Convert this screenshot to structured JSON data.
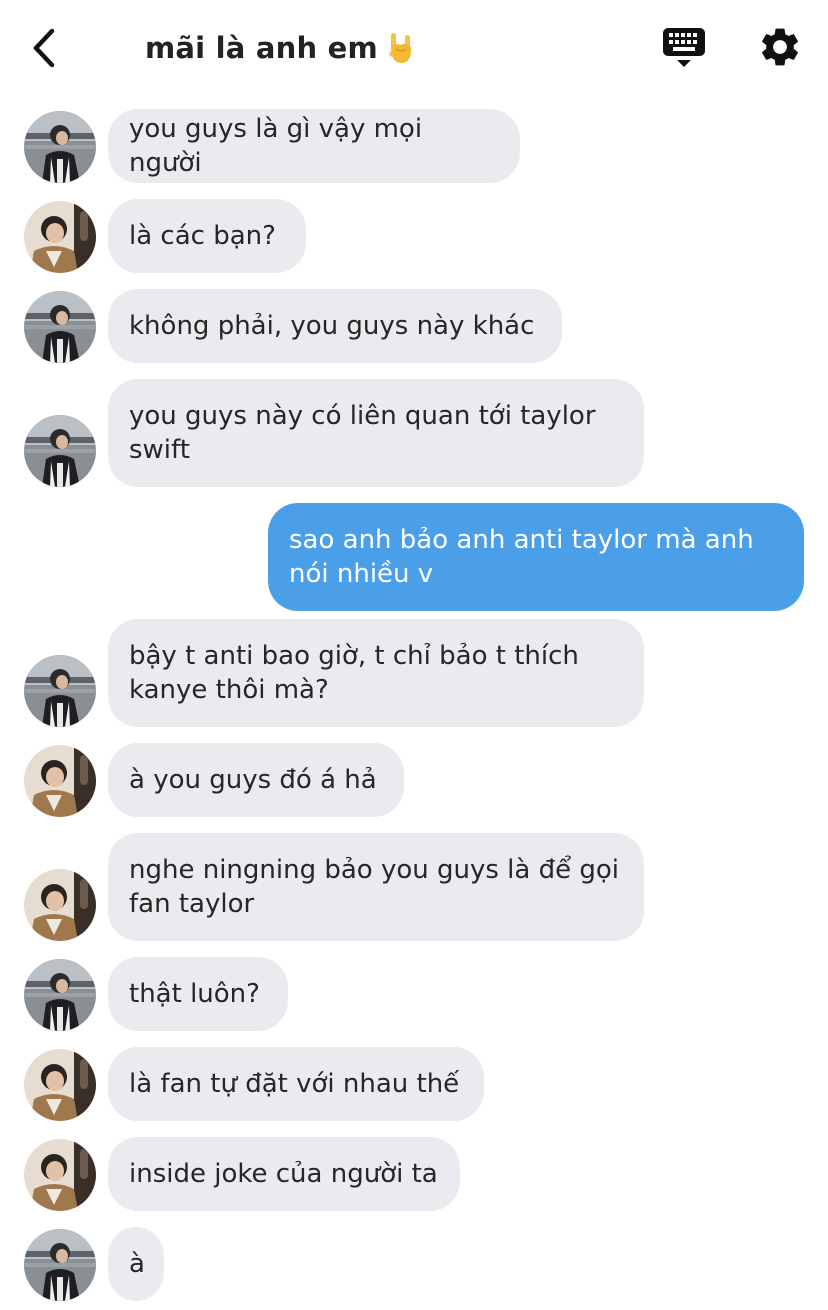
{
  "header": {
    "title": "mãi là anh em",
    "emoji": "🤘"
  },
  "icons": {
    "back": "chevron-left-icon",
    "keyboard": "keyboard-icon",
    "settings": "gear-icon"
  },
  "colors": {
    "incoming_bubble": "#e9ebef",
    "outgoing_bubble": "#4b9fe8",
    "text": "#262626"
  },
  "messages": [
    {
      "sender": "friend-a",
      "text": "you guys là gì vậy mọi người"
    },
    {
      "sender": "friend-b",
      "text": "là các bạn?"
    },
    {
      "sender": "friend-a",
      "text": "không phải, you guys này khác"
    },
    {
      "sender": "friend-a",
      "text": "you guys này có liên quan tới taylor swift"
    },
    {
      "sender": "me",
      "text": "sao anh bảo anh anti taylor mà anh nói nhiều v"
    },
    {
      "sender": "friend-a",
      "text": "bậy t anti bao giờ, t chỉ bảo t thích kanye thôi mà?"
    },
    {
      "sender": "friend-b",
      "text": "à you guys đó á hả"
    },
    {
      "sender": "friend-b",
      "text": "nghe ningning bảo you guys là để gọi fan taylor"
    },
    {
      "sender": "friend-a",
      "text": "thật luôn?"
    },
    {
      "sender": "friend-b",
      "text": "là fan tự đặt với nhau thế"
    },
    {
      "sender": "friend-b",
      "text": "inside joke của người ta"
    },
    {
      "sender": "friend-a",
      "text": "à"
    }
  ]
}
